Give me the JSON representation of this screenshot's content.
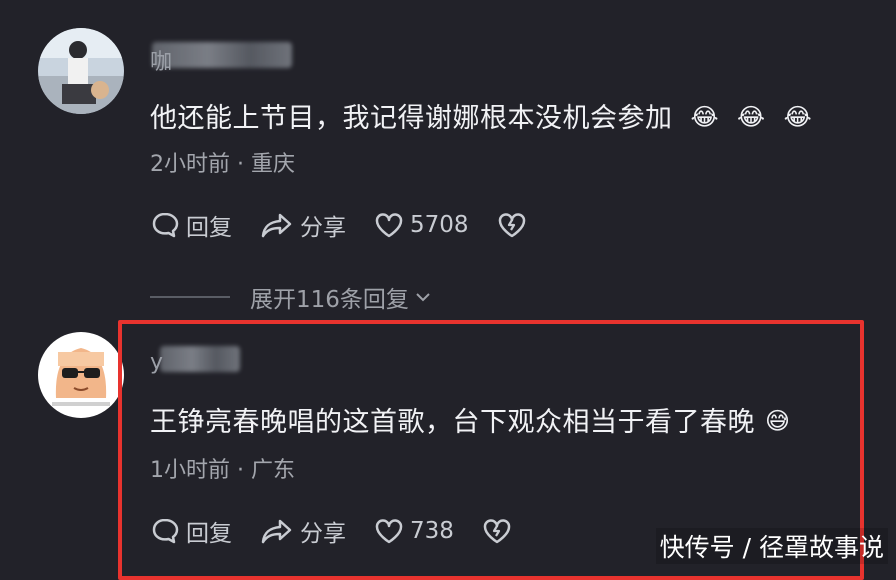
{
  "comments": [
    {
      "username_visible": "咖",
      "text": "他还能上节目，我记得谢娜根本没机会参加",
      "emojis": [
        "😂",
        "😂",
        "😂"
      ],
      "time": "2小时前",
      "location": "重庆",
      "meta_sep": " · ",
      "reply_label": "回复",
      "share_label": "分享",
      "like_count": "5708",
      "expand_label": "展开116条回复"
    },
    {
      "username_visible": "y",
      "text": "王铮亮春晚唱的这首歌，台下观众相当于看了春晚",
      "emojis": [
        "😅"
      ],
      "time": "1小时前",
      "location": "广东",
      "meta_sep": " · ",
      "reply_label": "回复",
      "share_label": "分享",
      "like_count": "738"
    }
  ],
  "watermark": "快传号 / 径罩故事说",
  "colors": {
    "background": "#222229",
    "highlight_border": "#e8332e"
  },
  "icons": [
    "comment-bubble-icon",
    "share-arrow-icon",
    "heart-icon",
    "broken-heart-icon",
    "chevron-down-icon"
  ]
}
